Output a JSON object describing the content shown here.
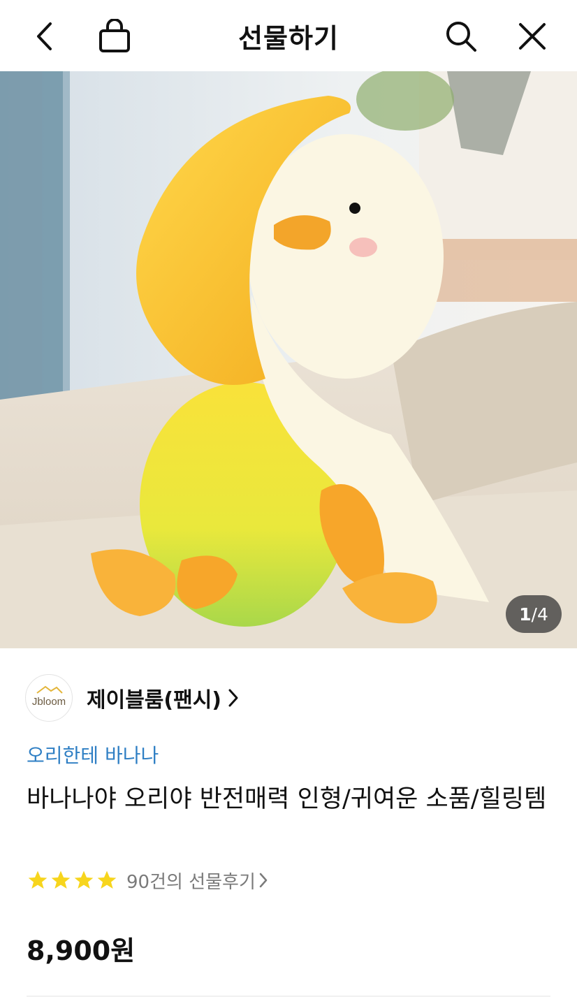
{
  "header": {
    "title": "선물하기"
  },
  "gallery": {
    "current": "1",
    "total": "/4"
  },
  "store": {
    "logo_text": "Jbloom",
    "name": "제이블룸(팬시)"
  },
  "product": {
    "tagline": "오리한테 바나나",
    "title": "바나나야 오리야 반전매력 인형/귀여운 소품/힐링템",
    "rating_stars": 4,
    "review_text": "90건의 선물후기",
    "price": "8,900원"
  },
  "colors": {
    "accent_link": "#2f7fc4",
    "star": "#f7d51d"
  }
}
